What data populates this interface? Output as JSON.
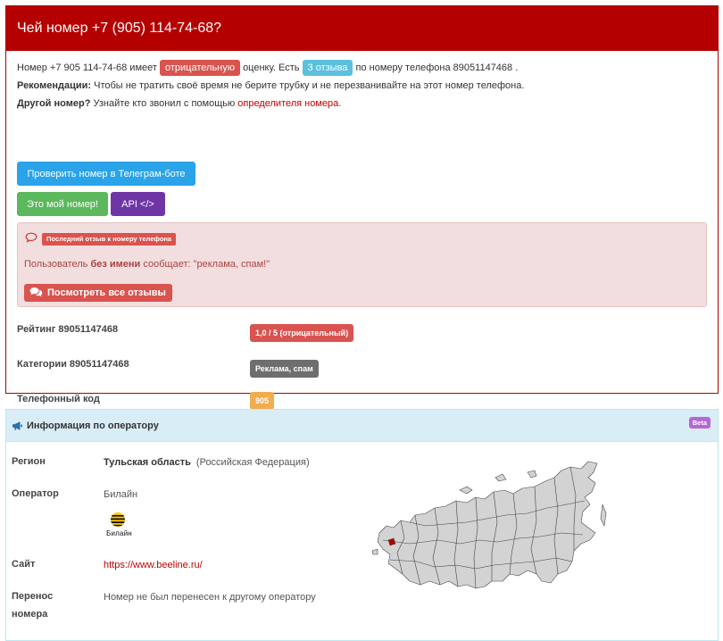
{
  "header": {
    "title": "Чей номер +7 (905) 114-74-68?"
  },
  "summary": {
    "prefix": "Номер +7 905 114-74-68 имеет",
    "rating_badge": "отрицательную",
    "middle": "оценку. Есть",
    "reviews_badge": "3 отзыва",
    "suffix": "по номеру телефона 89051147468 ."
  },
  "recommendation": {
    "label": "Рекомендации:",
    "text": "Чтобы не тратить своё время не берите трубку и не перезванивайте на этот номер телефона."
  },
  "other_number": {
    "label": "Другой номер?",
    "text": "Узнайте кто звонил с помощью",
    "link": "определителя номера",
    "end": "."
  },
  "buttons": {
    "telegram": "Проверить номер в Телеграм-боте",
    "mine": "Это мой номер!",
    "api": "API </>"
  },
  "last_review": {
    "badge": "Последний отзыв к номеру телефона",
    "user_prefix": "Пользователь",
    "user_name": "без имени",
    "says": "сообщает: \"реклама, спам!\"",
    "all_reviews_button": "Посмотреть все отзывы"
  },
  "details": {
    "rating_label": "Рейтинг 89051147468",
    "rating_value": "1,0 / 5 (отрицательный)",
    "categories_label": "Категории 89051147468",
    "categories_value": "Реклама, спам",
    "code_label": "Телефонный код",
    "code_value": "905"
  },
  "operator_panel": {
    "title": "Информация по оператору",
    "beta": "Beta",
    "region_label": "Регион",
    "region_value": "Тульская область",
    "region_country": "(Российская Федерация)",
    "operator_label": "Оператор",
    "operator_value": "Билайн",
    "logo_text": "Билайн",
    "site_label": "Сайт",
    "site_value": "https://www.beeline.ru/",
    "transfer_label_1": "Перенос",
    "transfer_label_2": "номера",
    "transfer_value": "Номер не был перенесен к другому оператору"
  },
  "colors": {
    "header_red": "#b50000",
    "danger": "#d9534f",
    "info": "#5bc0de",
    "telegram_blue": "#2aa3e8",
    "success": "#5cb85c",
    "api_purple": "#6f35a5",
    "warning": "#f0ad4e",
    "beta_purple": "#b866d4",
    "map_highlight": "#b00000"
  },
  "icons": [
    "comment-icon",
    "comments-icon",
    "megaphone-icon",
    "beeline-logo",
    "russia-map"
  ]
}
